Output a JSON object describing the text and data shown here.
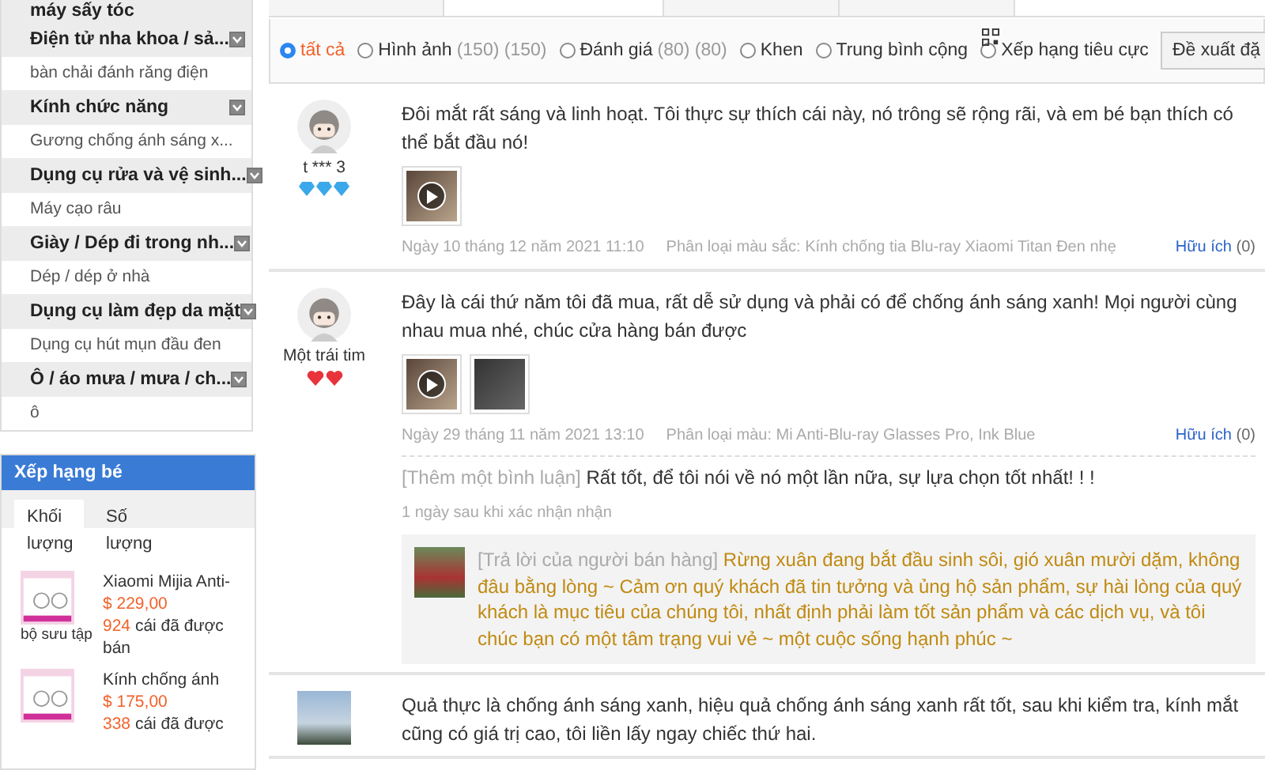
{
  "sidebar": {
    "categories": [
      {
        "kind": "heading",
        "title": "máy sấy tóc"
      },
      {
        "kind": "group",
        "title": "Điện tử nha khoa / sả...",
        "sub": "bàn chải đánh răng điện"
      },
      {
        "kind": "group",
        "title": "Kính chức năng",
        "sub": "Gương chống ánh sáng x..."
      },
      {
        "kind": "group",
        "title": "Dụng cụ rửa và vệ sinh...",
        "sub": "Máy cạo râu"
      },
      {
        "kind": "group",
        "title": "Giày / Dép đi trong nh...",
        "sub": "Dép / dép ở nhà"
      },
      {
        "kind": "group",
        "title": "Dụng cụ làm đẹp da mặt",
        "sub": "Dụng cụ hút mụn đầu đen"
      },
      {
        "kind": "group",
        "title": "Ô / áo mưa / mưa / ch...",
        "sub": "ô"
      }
    ],
    "ranking": {
      "title": "Xếp hạng bé",
      "tabs": [
        {
          "label": "Khối lượng",
          "selected": true
        },
        {
          "label": "Số lượng",
          "selected": false
        }
      ],
      "items": [
        {
          "name": "Xiaomi Mijia Anti-",
          "tag": "bộ sưu tập",
          "price": "$ 229,00",
          "sold": "924",
          "sold_text": "cái đã được bán"
        },
        {
          "name": "Kính chống ánh",
          "price": "$ 175,00",
          "sold": "338",
          "sold_text": "cái đã được"
        }
      ]
    }
  },
  "page_tabs": [
    {
      "selected": false
    },
    {
      "selected": true
    },
    {
      "selected": false
    },
    {
      "selected": false
    }
  ],
  "filters": [
    {
      "label": "tất cả",
      "selected": true
    },
    {
      "label": "Hình ảnh",
      "count": "(150) (150)",
      "selected": false
    },
    {
      "label": "Đánh giá",
      "count": "(80) (80)",
      "selected": false
    },
    {
      "label": "Khen",
      "selected": false
    },
    {
      "label": "Trung bình cộng",
      "selected": false
    },
    {
      "label": "Xếp hạng tiêu cực",
      "selected": false
    }
  ],
  "sort": {
    "value": "Đề xuất đặ"
  },
  "reviews": [
    {
      "user": "t *** 3",
      "badges": [
        {
          "kind": "diamond"
        },
        {
          "kind": "diamond"
        },
        {
          "kind": "diamond"
        }
      ],
      "text": "Đôi mắt rất sáng và linh hoạt. Tôi thực sự thích cái này, nó trông sẽ rộng rãi, và em bé bạn thích có thể bắt đầu nó!",
      "media": [
        {
          "kind": "video"
        }
      ],
      "date": "Ngày 10 tháng 12 năm 2021 11:10",
      "variant": "Phân loại màu sắc: Kính chống tia Blu-ray Xiaomi Titan Đen nhẹ",
      "helpful": "Hữu ích",
      "helpful_count": "(0)"
    },
    {
      "user": "Một trái tim",
      "badges": [
        {
          "kind": "heart"
        },
        {
          "kind": "heart"
        }
      ],
      "text": "Đây là cái thứ năm tôi đã mua, rất dễ sử dụng và phải có để chống ánh sáng xanh! Mọi người cùng nhau mua nhé, chúc cửa hàng bán được",
      "media": [
        {
          "kind": "video"
        },
        {
          "kind": "photo"
        }
      ],
      "date": "Ngày 29 tháng 11 năm 2021 13:10",
      "variant": "Phân loại màu: Mi Anti-Blu-ray Glasses Pro, Ink Blue",
      "helpful": "Hữu ích",
      "helpful_count": "(0)",
      "followup": {
        "label": "[Thêm một bình luận]",
        "text": "Rất tốt, để tôi nói về nó một lần nữa, sự lựa chọn tốt nhất! ! !",
        "time": "1 ngày sau khi xác nhận nhận"
      },
      "reply": {
        "label": "[Trả lời của người bán hàng]",
        "text": "Rừng xuân đang bắt đầu sinh sôi, gió xuân mười dặm, không đâu bằng lòng ~ Cảm ơn quý khách đã tin tưởng và ủng hộ sản phẩm, sự hài lòng của quý khách là mục tiêu của chúng tôi, nhất định phải làm tốt sản phẩm và các dịch vụ, và tôi chúc bạn có một tâm trạng vui vẻ ~ một cuộc sống hạnh phúc ~"
      }
    },
    {
      "text": "Quả thực là chống ánh sáng xanh, hiệu quả chống ánh sáng xanh rất tốt, sau khi kiểm tra, kính mắt cũng có giá trị cao, tôi liền lấy ngay chiếc thứ hai."
    }
  ]
}
